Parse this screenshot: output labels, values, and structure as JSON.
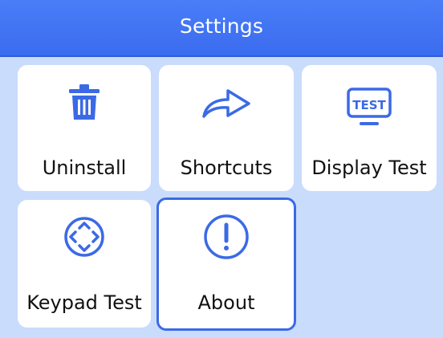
{
  "header": {
    "title": "Settings"
  },
  "tiles": [
    {
      "label": "Uninstall",
      "icon": "trash-icon"
    },
    {
      "label": "Shortcuts",
      "icon": "share-arrow-icon"
    },
    {
      "label": "Display Test",
      "icon": "monitor-test-icon",
      "icon_text": "TEST"
    },
    {
      "label": "Keypad Test",
      "icon": "keypad-directions-icon"
    },
    {
      "label": "About",
      "icon": "info-exclamation-icon",
      "selected": true
    }
  ],
  "colors": {
    "header_blue": "#3f73f3",
    "background": "#cadcfb",
    "accent": "#3b6ae6",
    "tile": "#ffffff",
    "text": "#111111"
  }
}
